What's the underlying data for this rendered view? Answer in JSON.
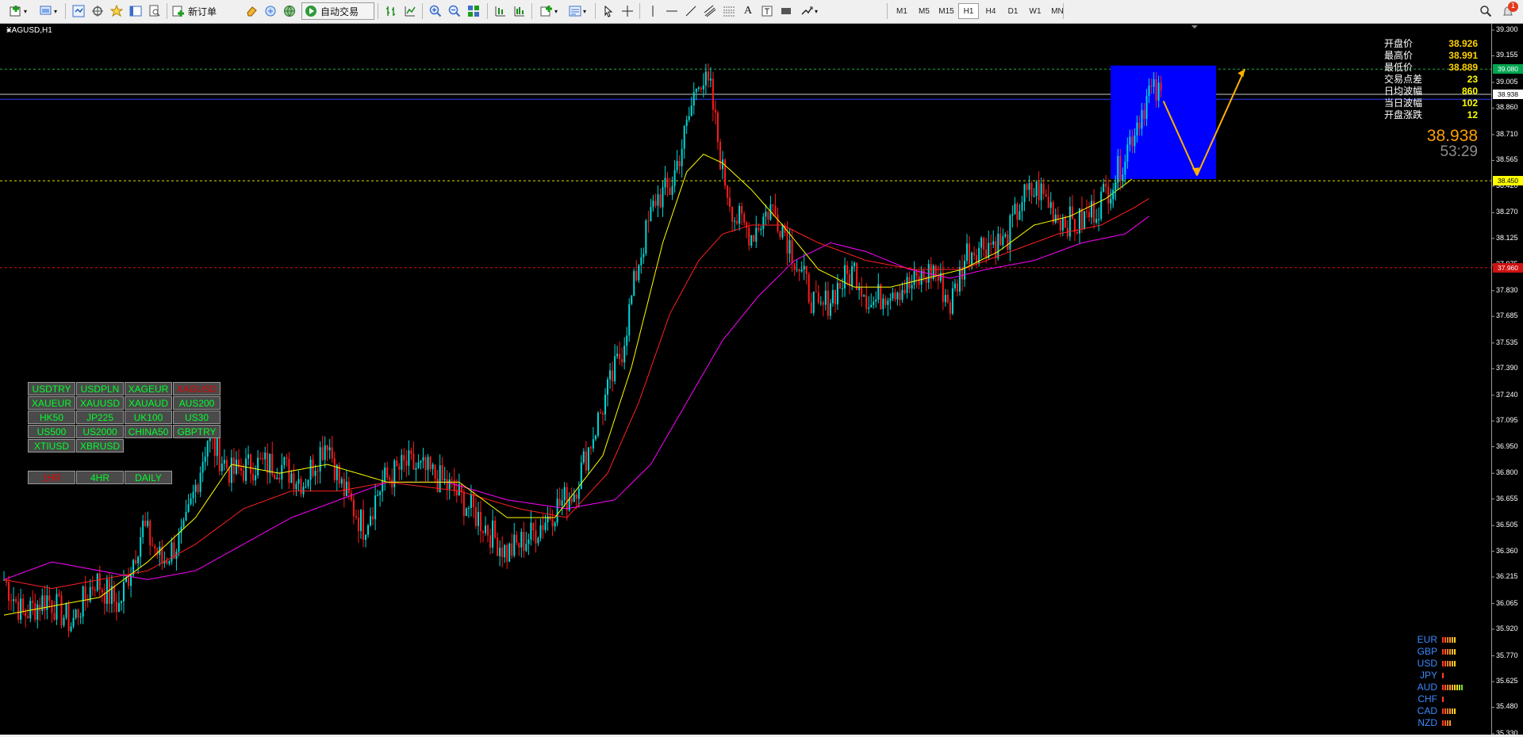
{
  "toolbar": {
    "new_order_label": "新订单",
    "auto_trade_label": "自动交易",
    "timeframes": [
      "M1",
      "M5",
      "M15",
      "H1",
      "H4",
      "D1",
      "W1",
      "MN"
    ],
    "active_timeframe": "H1",
    "notification_count": "1"
  },
  "chart": {
    "symbol_title": "XAGUSD,H1",
    "info": [
      {
        "label": "开盘价",
        "value": "38.926"
      },
      {
        "label": "最高价",
        "value": "38.991"
      },
      {
        "label": "最低价",
        "value": "38.889"
      },
      {
        "label": "交易点差",
        "value": "23"
      },
      {
        "label": "日均波幅",
        "value": "860"
      },
      {
        "label": "当日波幅",
        "value": "102"
      },
      {
        "label": "开盘涨跌",
        "value": "12"
      }
    ],
    "current_price": "38.938",
    "countdown": "53:29",
    "price_labels": {
      "top_green": "39.080",
      "current": "38.938",
      "yellow": "38.450",
      "red": "37.960"
    },
    "colors": {
      "bull": "#00d7d7",
      "bear": "#ff1a1a",
      "ma_fast": "#ffff00",
      "ma_mid": "#ff2020",
      "ma_slow": "#ff00ff",
      "box": "#0000ff",
      "arrow": "#ffb000"
    }
  },
  "symbol_buttons": [
    "USDTRY",
    "USDPLN",
    "XAGEUR",
    "XAGUSD",
    "XAUEUR",
    "XAUUSD",
    "XAUAUD",
    "AUS200",
    "HK50",
    "JP225",
    "UK100",
    "US30",
    "US500",
    "US2000",
    "CHINA50",
    "GBPTRY",
    "XTIUSD",
    "XBRUSD"
  ],
  "active_symbol": "XAGUSD",
  "timeframe_buttons": [
    "1HR",
    "4HR",
    "DAILY"
  ],
  "active_tf_button": "1HR",
  "currency_strength": [
    {
      "currency": "EUR",
      "level": 6
    },
    {
      "currency": "GBP",
      "level": 6
    },
    {
      "currency": "USD",
      "level": 6
    },
    {
      "currency": "JPY",
      "level": 1
    },
    {
      "currency": "AUD",
      "level": 9
    },
    {
      "currency": "CHF",
      "level": 1
    },
    {
      "currency": "CAD",
      "level": 6
    },
    {
      "currency": "NZD",
      "level": 4
    }
  ],
  "chart_data": {
    "type": "candlestick",
    "yticks": [
      "39.300",
      "39.155",
      "39.005",
      "38.860",
      "38.710",
      "38.565",
      "38.420",
      "38.270",
      "38.125",
      "37.975",
      "37.830",
      "37.685",
      "37.535",
      "37.390",
      "37.240",
      "37.095",
      "36.950",
      "36.800",
      "36.655",
      "36.505",
      "36.360",
      "36.215",
      "36.065",
      "35.920",
      "35.770",
      "35.625",
      "35.480",
      "35.330"
    ],
    "ylim": [
      35.33,
      39.3
    ],
    "levels": [
      39.08,
      38.938,
      38.91,
      38.45,
      37.96
    ],
    "anchors": [
      [
        0,
        36.2
      ],
      [
        8,
        36.0
      ],
      [
        18,
        36.1
      ],
      [
        28,
        35.95
      ],
      [
        38,
        36.2
      ],
      [
        48,
        36.05
      ],
      [
        58,
        36.5
      ],
      [
        66,
        36.3
      ],
      [
        75,
        36.45
      ],
      [
        85,
        37.0
      ],
      [
        95,
        36.8
      ],
      [
        105,
        36.85
      ],
      [
        115,
        36.85
      ],
      [
        125,
        36.75
      ],
      [
        135,
        37.0
      ],
      [
        140,
        36.75
      ],
      [
        150,
        36.5
      ],
      [
        158,
        36.75
      ],
      [
        168,
        36.85
      ],
      [
        178,
        36.8
      ],
      [
        188,
        36.7
      ],
      [
        198,
        36.55
      ],
      [
        210,
        36.35
      ],
      [
        220,
        36.45
      ],
      [
        230,
        36.6
      ],
      [
        238,
        36.7
      ],
      [
        248,
        37.1
      ],
      [
        258,
        37.5
      ],
      [
        265,
        38.0
      ],
      [
        272,
        38.35
      ],
      [
        278,
        38.4
      ],
      [
        285,
        38.75
      ],
      [
        290,
        39.05
      ],
      [
        295,
        38.95
      ],
      [
        300,
        38.5
      ],
      [
        305,
        38.25
      ],
      [
        312,
        38.15
      ],
      [
        320,
        38.3
      ],
      [
        325,
        38.2
      ],
      [
        332,
        37.95
      ],
      [
        340,
        37.7
      ],
      [
        348,
        37.85
      ],
      [
        355,
        37.95
      ],
      [
        362,
        37.75
      ],
      [
        370,
        37.85
      ],
      [
        378,
        37.85
      ],
      [
        388,
        37.95
      ],
      [
        395,
        37.75
      ],
      [
        402,
        38.05
      ],
      [
        410,
        38.1
      ],
      [
        418,
        38.1
      ],
      [
        425,
        38.35
      ],
      [
        432,
        38.4
      ],
      [
        440,
        38.25
      ],
      [
        448,
        38.2
      ],
      [
        456,
        38.3
      ],
      [
        465,
        38.5
      ],
      [
        472,
        38.75
      ],
      [
        478,
        38.95
      ],
      [
        483,
        38.93
      ]
    ],
    "ma_fast": [
      [
        0,
        36.0
      ],
      [
        20,
        36.05
      ],
      [
        40,
        36.1
      ],
      [
        60,
        36.3
      ],
      [
        80,
        36.55
      ],
      [
        95,
        36.85
      ],
      [
        115,
        36.8
      ],
      [
        135,
        36.85
      ],
      [
        160,
        36.75
      ],
      [
        190,
        36.75
      ],
      [
        210,
        36.55
      ],
      [
        230,
        36.55
      ],
      [
        250,
        36.9
      ],
      [
        262,
        37.4
      ],
      [
        275,
        38.1
      ],
      [
        285,
        38.5
      ],
      [
        292,
        38.6
      ],
      [
        300,
        38.55
      ],
      [
        312,
        38.4
      ],
      [
        325,
        38.2
      ],
      [
        340,
        37.95
      ],
      [
        355,
        37.85
      ],
      [
        370,
        37.85
      ],
      [
        385,
        37.9
      ],
      [
        400,
        37.95
      ],
      [
        415,
        38.05
      ],
      [
        430,
        38.2
      ],
      [
        445,
        38.25
      ],
      [
        460,
        38.35
      ],
      [
        470,
        38.45
      ],
      [
        478,
        38.55
      ]
    ],
    "ma_mid": [
      [
        0,
        36.2
      ],
      [
        20,
        36.15
      ],
      [
        40,
        36.2
      ],
      [
        60,
        36.25
      ],
      [
        80,
        36.4
      ],
      [
        100,
        36.6
      ],
      [
        120,
        36.7
      ],
      [
        140,
        36.7
      ],
      [
        160,
        36.75
      ],
      [
        190,
        36.7
      ],
      [
        215,
        36.6
      ],
      [
        235,
        36.55
      ],
      [
        252,
        36.8
      ],
      [
        265,
        37.2
      ],
      [
        278,
        37.7
      ],
      [
        290,
        38.0
      ],
      [
        300,
        38.15
      ],
      [
        312,
        38.2
      ],
      [
        325,
        38.2
      ],
      [
        340,
        38.1
      ],
      [
        360,
        38.0
      ],
      [
        380,
        37.95
      ],
      [
        400,
        37.95
      ],
      [
        420,
        38.05
      ],
      [
        440,
        38.15
      ],
      [
        458,
        38.2
      ],
      [
        472,
        38.3
      ],
      [
        478,
        38.35
      ]
    ],
    "ma_slow": [
      [
        0,
        36.2
      ],
      [
        20,
        36.3
      ],
      [
        40,
        36.25
      ],
      [
        60,
        36.2
      ],
      [
        80,
        36.25
      ],
      [
        100,
        36.4
      ],
      [
        120,
        36.55
      ],
      [
        140,
        36.65
      ],
      [
        160,
        36.75
      ],
      [
        185,
        36.75
      ],
      [
        210,
        36.65
      ],
      [
        235,
        36.6
      ],
      [
        255,
        36.65
      ],
      [
        270,
        36.85
      ],
      [
        285,
        37.2
      ],
      [
        300,
        37.55
      ],
      [
        315,
        37.8
      ],
      [
        330,
        38.0
      ],
      [
        345,
        38.1
      ],
      [
        360,
        38.05
      ],
      [
        378,
        37.95
      ],
      [
        395,
        37.9
      ],
      [
        410,
        37.95
      ],
      [
        430,
        38.0
      ],
      [
        450,
        38.1
      ],
      [
        468,
        38.15
      ],
      [
        478,
        38.25
      ]
    ]
  }
}
